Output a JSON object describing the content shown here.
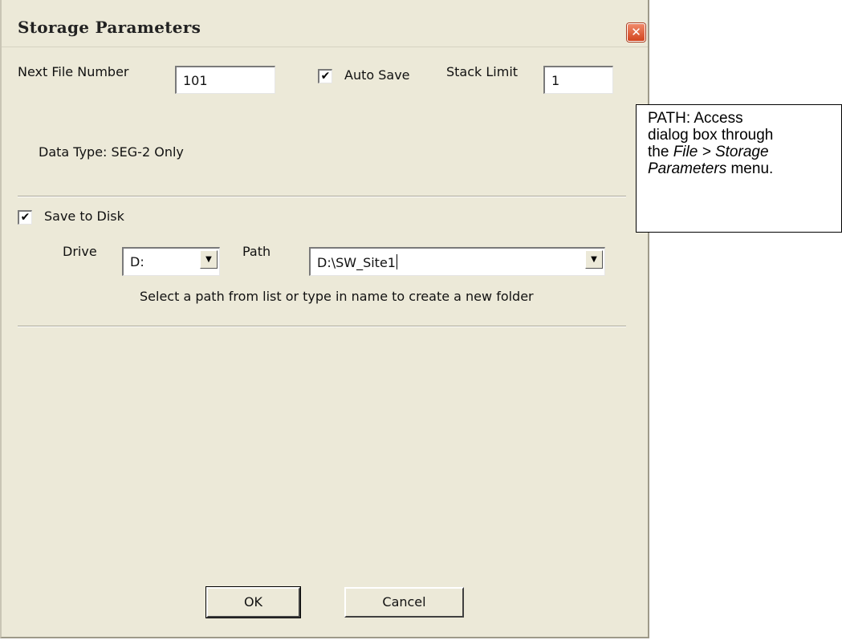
{
  "window": {
    "title": "Storage Parameters",
    "close_glyph": "✕"
  },
  "general": {
    "next_file_label": "Next File Number",
    "next_file_value": "101",
    "auto_save_label": "Auto Save",
    "auto_save_checked": true,
    "stack_limit_label": "Stack Limit",
    "stack_limit_value": "1",
    "data_type_text": "Data Type: SEG-2 Only"
  },
  "disk": {
    "save_label": "Save to Disk",
    "save_checked": true,
    "drive_label": "Drive",
    "drive_value": "D:",
    "path_label": "Path",
    "path_value": "D:\\SW_Site1",
    "hint": "Select a path from list or type in name to create a new folder"
  },
  "buttons": {
    "ok": "OK",
    "cancel": "Cancel"
  },
  "note": {
    "line1": "PATH: Access",
    "line2": "dialog box through",
    "line3_prefix": "the ",
    "line3_italic": "File > Storage",
    "line4_italic": "Parameters",
    "line4_suffix": " menu."
  },
  "icons": {
    "checkmark": "✔",
    "dropdown": "▼"
  }
}
